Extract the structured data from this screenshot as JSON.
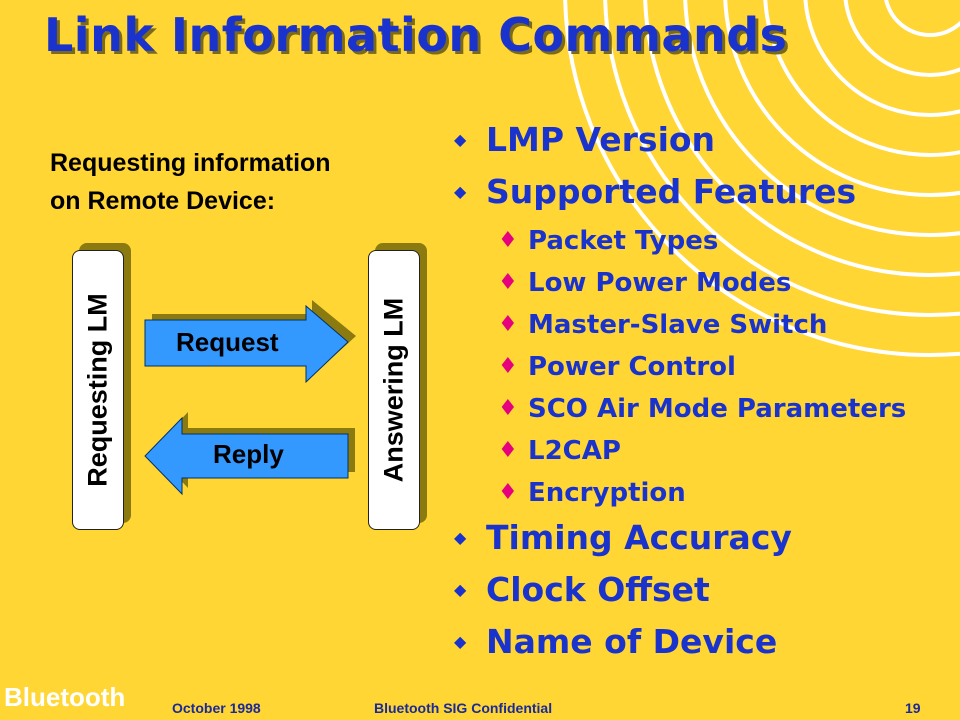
{
  "title": "Link Information Commands",
  "subtitle": [
    "Requesting information",
    "on Remote Device:"
  ],
  "diagram": {
    "left_box": "Requesting LM",
    "right_box": "Answering LM",
    "request_label": "Request",
    "reply_label": "Reply"
  },
  "bullets": [
    {
      "text": "LMP Version",
      "level": 1
    },
    {
      "text": "Supported Features",
      "level": 1
    },
    {
      "text": "Packet Types",
      "level": 2
    },
    {
      "text": "Low Power Modes",
      "level": 2
    },
    {
      "text": "Master-Slave Switch",
      "level": 2
    },
    {
      "text": "Power Control",
      "level": 2
    },
    {
      "text": "SCO Air Mode Parameters",
      "level": 2
    },
    {
      "text": "L2CAP",
      "level": 2
    },
    {
      "text": "Encryption",
      "level": 2
    },
    {
      "text": "Timing Accuracy",
      "level": 1
    },
    {
      "text": "Clock Offset",
      "level": 1
    },
    {
      "text": "Name of Device",
      "level": 1
    }
  ],
  "footer": {
    "logo": "Bluetooth",
    "date": "October 1998",
    "confidential": "Bluetooth SIG Confidential",
    "page": "19"
  },
  "colors": {
    "background": "#FFD633",
    "title": "#1A33CC",
    "sub_bullet": "#E6007E",
    "arrow": "#3399FF"
  }
}
